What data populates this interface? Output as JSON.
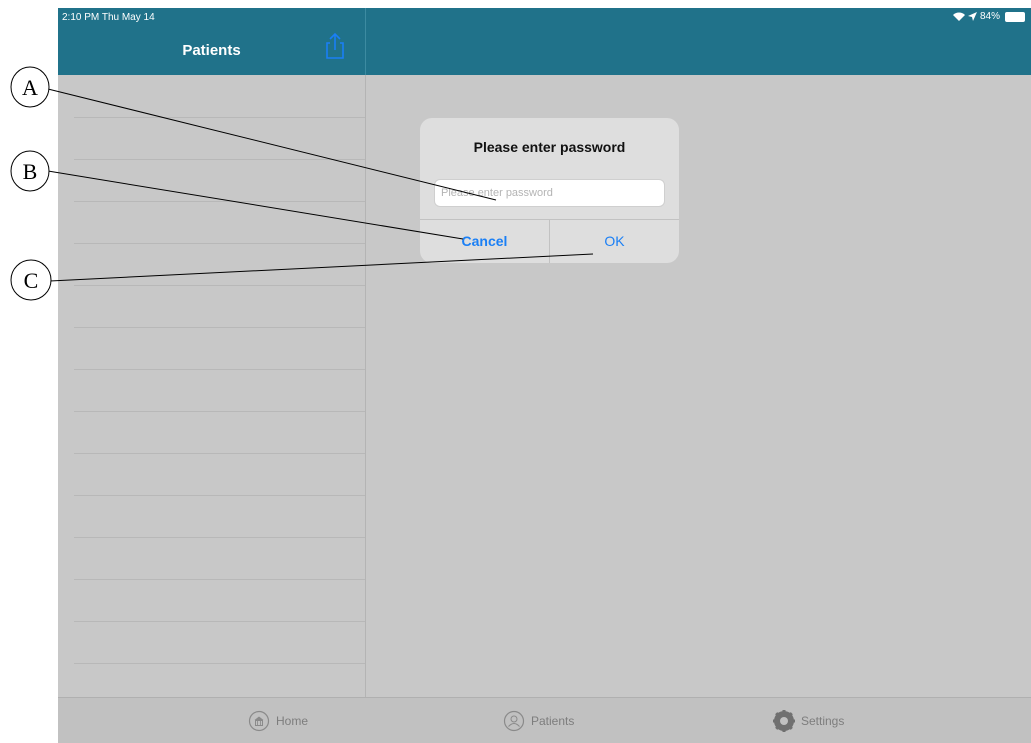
{
  "status_bar": {
    "time": "2:10 PM  Thu May 14",
    "battery": "84%"
  },
  "master": {
    "title": "Patients",
    "row_count": 14
  },
  "dialog": {
    "title": "Please enter password",
    "input_placeholder": "Please enter password",
    "input_value": "",
    "cancel_label": "Cancel",
    "ok_label": "OK"
  },
  "tab_bar": {
    "items": [
      {
        "label": "Home",
        "icon": "home-icon"
      },
      {
        "label": "Patients",
        "icon": "patients-icon"
      },
      {
        "label": "Settings",
        "icon": "gear-icon"
      }
    ]
  },
  "annotations": {
    "labels": [
      "A",
      "B",
      "C"
    ]
  },
  "colors": {
    "header_teal": "#20728a",
    "background_gray": "#c8c8c8",
    "dialog_bg": "#dedede",
    "action_blue": "#1a7ff5"
  }
}
